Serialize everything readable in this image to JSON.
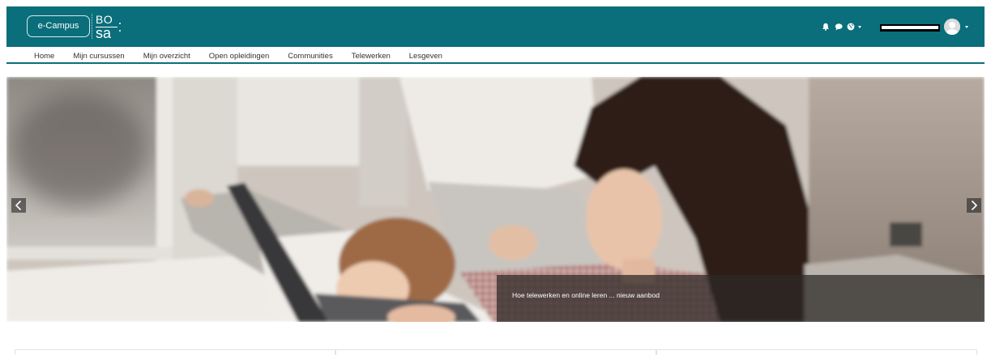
{
  "brand": {
    "ecampus_label": "e-Campus",
    "bosa_top": "BO",
    "bosa_bottom": "sa"
  },
  "header": {
    "notifications_icon": "bell-icon",
    "messages_icon": "chat-bubble-icon",
    "language_icon": "globe-icon",
    "language_caret_icon": "caret-down-icon",
    "avatar_icon": "user-avatar-icon",
    "user_caret_icon": "caret-down-icon"
  },
  "nav": {
    "items": [
      {
        "label": "Home"
      },
      {
        "label": "Mijn cursussen"
      },
      {
        "label": "Mijn overzicht"
      },
      {
        "label": "Open opleidingen"
      },
      {
        "label": "Communities"
      },
      {
        "label": "Telewerken"
      },
      {
        "label": "Lesgeven"
      }
    ]
  },
  "carousel": {
    "caption": "Hoe telewerken en online leren ... nieuw aanbod",
    "prev_icon": "chevron-left-icon",
    "next_icon": "chevron-right-icon"
  },
  "colors": {
    "brand_teal": "#0a6e7b",
    "nav_text": "#333333",
    "caption_background": "rgba(44,40,38,0.74)"
  }
}
